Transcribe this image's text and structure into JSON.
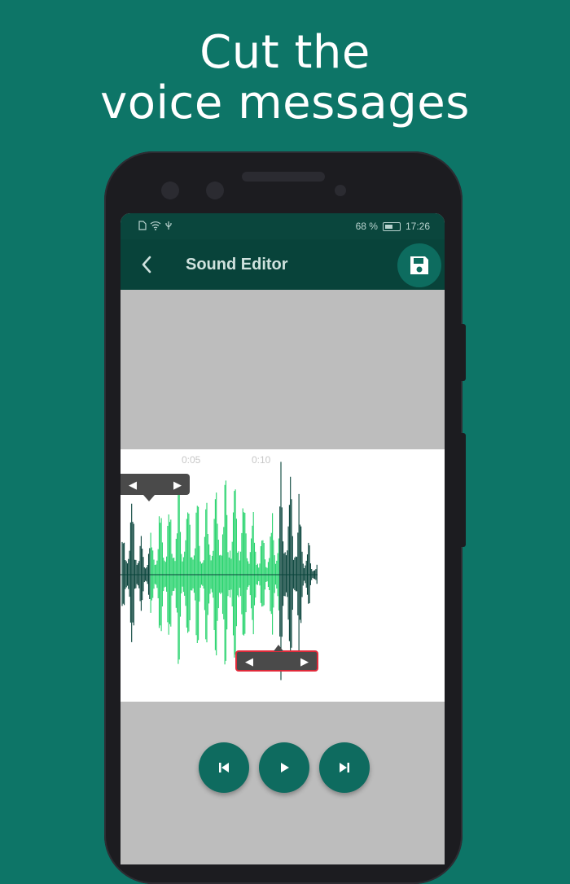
{
  "headline": {
    "line1": "Cut the",
    "line2": "voice messages"
  },
  "status_bar": {
    "battery": "68 %",
    "time": "17:26"
  },
  "toolbar": {
    "title": "Sound Editor"
  },
  "waveform": {
    "tick_labels": [
      "0:05",
      "0:10"
    ],
    "selection_start_fraction": 0.09,
    "selection_end_fraction": 0.49
  },
  "icons": {
    "back": "chevron-left-icon",
    "save": "floppy-disk-icon",
    "skip_start": "skip-previous-icon",
    "play": "play-icon",
    "skip_end": "skip-next-icon"
  },
  "colors": {
    "background": "#0d7567",
    "toolbar": "#08433a",
    "wave_selected": "#27d36d",
    "wave_unselected": "#08433a",
    "handle_highlight": "#e02a3a"
  }
}
